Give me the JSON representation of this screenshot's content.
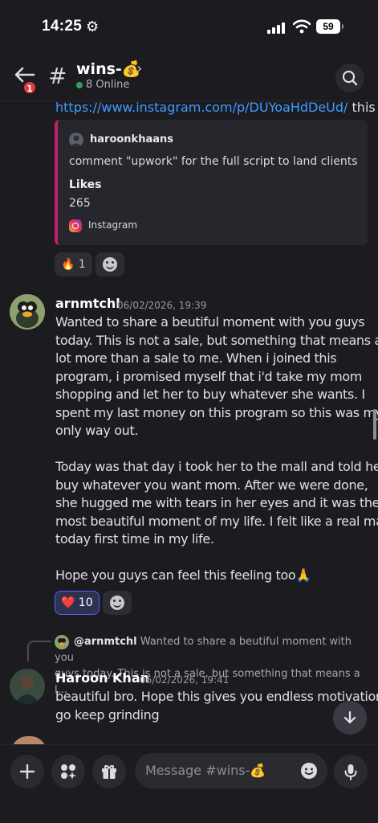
{
  "status_bar": {
    "time": "14:25",
    "battery": "59"
  },
  "header": {
    "back_badge": "1",
    "channel_name": "wins-💰",
    "online": "8 Online"
  },
  "messages": {
    "link_prefix": "https://www.instagram.com/p/DUYoaHdDeUd/",
    "link_suffix": " this",
    "embed": {
      "author": "haroonkhaans",
      "description": "comment \"upwork\" for the full script to land clients",
      "field_name": "Likes",
      "field_value": "265",
      "footer": "Instagram"
    },
    "embed_reaction": {
      "emoji": "🔥",
      "count": "1"
    },
    "post": {
      "author": "arnmtchl",
      "timestamp": "06/02/2026, 19:39",
      "lines_p1": [
        "Wanted to share a beutiful moment with you guys",
        "today. This is not a sale, but something that means a",
        "lot more than a sale to me. When i joined this",
        "program, i promised myself that i'd take my mom",
        "shopping and let her to buy whatever she wants. I",
        "spent my last money on this program so this was my",
        "only way out."
      ],
      "lines_p2": [
        "Today was that day i took her to the mall and told her",
        "buy whatever you want mom. After we were done,",
        "she hugged me with tears in her eyes and it was the",
        "most beautiful moment of my life. I felt like a real man",
        "today first time in my life."
      ],
      "line_p3": "Hope you guys can feel this feeling too🙏",
      "reaction": {
        "emoji": "❤️",
        "count": "10"
      }
    },
    "reply": {
      "mention": "@arnmtchl",
      "quoted_1": " Wanted to share a beutiful moment with you",
      "quoted_2": "guys today. This is not a sale, but something that means a l...",
      "author": "Haroon Khan",
      "timestamp": "06/02/2026, 19:41",
      "lines": [
        "beautiful bro. Hope this gives you endless motivation",
        "go keep grinding"
      ]
    }
  },
  "composer": {
    "placeholder": "Message #wins-💰"
  },
  "colors": {
    "accent": "#5865f2",
    "link": "#3f9bff",
    "embed_border": "#c0206f",
    "online": "#2fa35a"
  }
}
